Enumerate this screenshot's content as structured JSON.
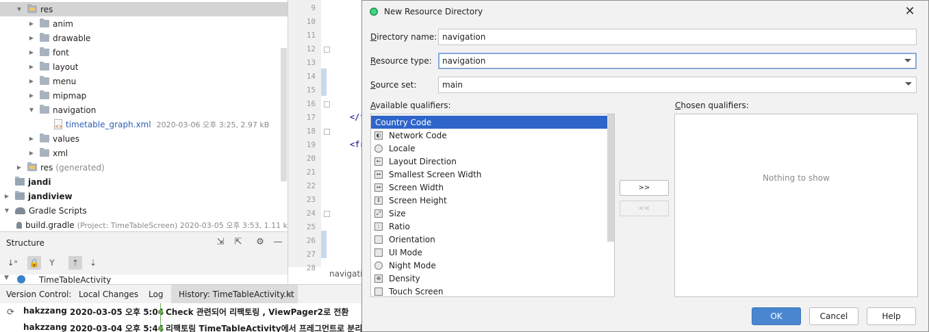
{
  "project_tree": {
    "rows": [
      {
        "label": "res",
        "meta": ""
      },
      {
        "label": "anim",
        "meta": ""
      },
      {
        "label": "drawable",
        "meta": ""
      },
      {
        "label": "font",
        "meta": ""
      },
      {
        "label": "layout",
        "meta": ""
      },
      {
        "label": "menu",
        "meta": ""
      },
      {
        "label": "mipmap",
        "meta": ""
      },
      {
        "label": "navigation",
        "meta": ""
      },
      {
        "label": "timetable_graph.xml",
        "meta": "2020-03-06 오후 3:25, 2.97 kB"
      },
      {
        "label": "values",
        "meta": ""
      },
      {
        "label": "xml",
        "meta": ""
      },
      {
        "label": "res",
        "meta": "(generated)"
      },
      {
        "label": "jandi",
        "meta": ""
      },
      {
        "label": "jandiview",
        "meta": ""
      },
      {
        "label": "Gradle Scripts",
        "meta": ""
      },
      {
        "label": "build.gradle",
        "meta": "(Project: TimeTableScreen)  2020-03-05 오후 3:53, 1.11 k"
      }
    ]
  },
  "structure": {
    "title": "Structure",
    "root_label": "TimeTableActivity"
  },
  "editor": {
    "line_numbers": [
      "9",
      "10",
      "11",
      "12",
      "13",
      "14",
      "15",
      "16",
      "17",
      "18",
      "19",
      "20",
      "21",
      "22",
      "23",
      "24",
      "25",
      "26",
      "27",
      "28"
    ],
    "fragments": [
      "</f",
      "<fr"
    ],
    "tab_label": "navigati"
  },
  "version_control": {
    "tabs": [
      "Version Control:",
      "Local Changes",
      "Log",
      "History: TimeTableActivity.kt"
    ],
    "close_glyph": "×",
    "commits": [
      {
        "author": "hakzzang",
        "date": "2020-03-05 오후 5:04",
        "message": "Check 관련되어 리팩토링 , ViewPager2로 전환"
      },
      {
        "author": "hakzzang",
        "date": "2020-03-04 오후 5:44",
        "message": "리팩토링 TimeTableActivity에서 프레그먼트로 분리,"
      }
    ]
  },
  "dialog": {
    "title": "New Resource Directory",
    "close_glyph": "✕",
    "directory_name": {
      "label_pre": "",
      "label_ul": "D",
      "label_post": "irectory name:",
      "value": "navigation"
    },
    "resource_type": {
      "label_pre": "",
      "label_ul": "R",
      "label_post": "esource type:",
      "value": "navigation"
    },
    "source_set": {
      "label_pre": "",
      "label_ul": "S",
      "label_post": "ource set:",
      "value": "main"
    },
    "available_label": {
      "pre": "",
      "ul": "A",
      "post": "vailable qualifiers:"
    },
    "chosen_label": {
      "pre": "",
      "ul": "C",
      "post": "hosen qualifiers:"
    },
    "qualifiers": [
      {
        "label": "Country Code",
        "icon": "globe-icon"
      },
      {
        "label": "Network Code",
        "icon": "network-icon"
      },
      {
        "label": "Locale",
        "icon": "globe-icon"
      },
      {
        "label": "Layout Direction",
        "icon": "direction-icon"
      },
      {
        "label": "Smallest Screen Width",
        "icon": "width-icon"
      },
      {
        "label": "Screen Width",
        "icon": "width-icon"
      },
      {
        "label": "Screen Height",
        "icon": "height-icon"
      },
      {
        "label": "Size",
        "icon": "size-icon"
      },
      {
        "label": "Ratio",
        "icon": "ratio-icon"
      },
      {
        "label": "Orientation",
        "icon": "orientation-icon"
      },
      {
        "label": "UI Mode",
        "icon": "ui-mode-icon"
      },
      {
        "label": "Night Mode",
        "icon": "moon-icon"
      },
      {
        "label": "Density",
        "icon": "density-icon"
      },
      {
        "label": "Touch Screen",
        "icon": "touch-icon"
      }
    ],
    "selected_qualifier": "Country Code",
    "move_right_label": ">>",
    "move_left_label": "<<",
    "chosen_empty_text": "Nothing to show",
    "ok_label": "OK",
    "cancel_label": "Cancel",
    "help_label": "Help"
  },
  "colors": {
    "selection": "#2f65ca",
    "ok_button": "#4a86d0",
    "link_text": "#2c5fb5",
    "android_green": "#3ddc84"
  }
}
